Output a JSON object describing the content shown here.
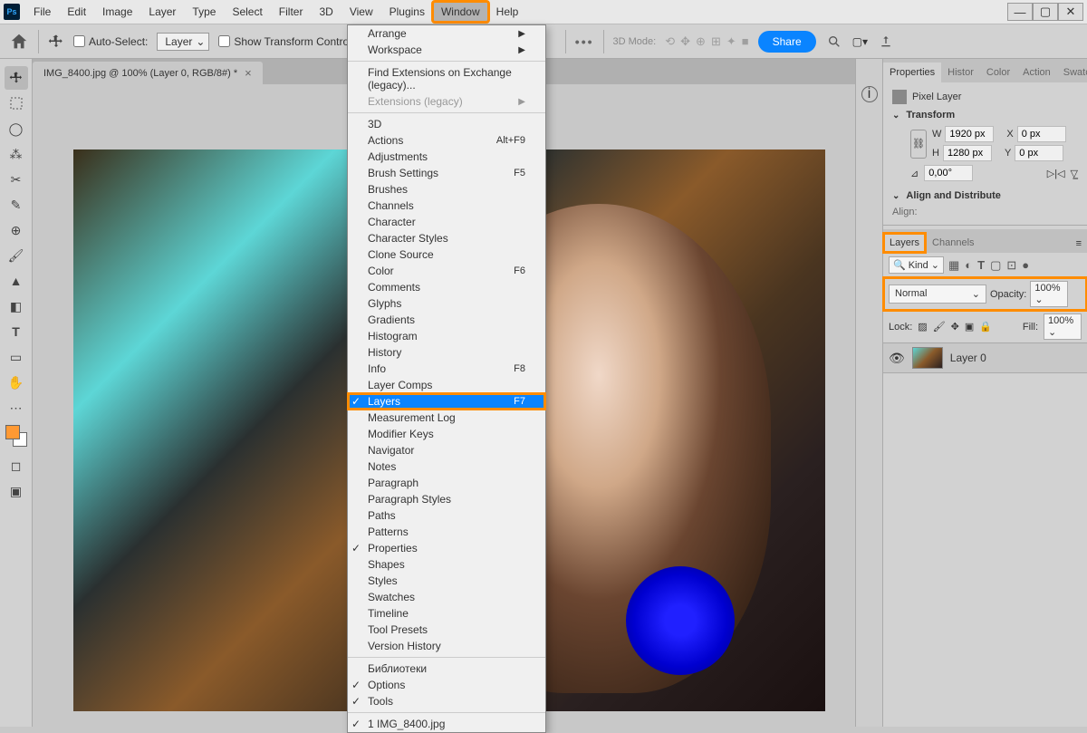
{
  "app": {
    "logo": "Ps"
  },
  "menubar": {
    "items": [
      "File",
      "Edit",
      "Image",
      "Layer",
      "Type",
      "Select",
      "Filter",
      "3D",
      "View",
      "Plugins",
      "Window",
      "Help"
    ],
    "active": "Window"
  },
  "window_controls": {
    "minimize": "—",
    "maximize": "▢",
    "close": "✕"
  },
  "optionsbar": {
    "auto_select": "Auto-Select:",
    "layer_select": "Layer",
    "show_transform": "Show Transform Controls",
    "mode3d": "3D Mode:",
    "share": "Share"
  },
  "doc_tab": {
    "label": "IMG_8400.jpg @ 100% (Layer 0, RGB/8#) *"
  },
  "dropdown": {
    "arrange": "Arrange",
    "workspace": "Workspace",
    "find_ext": "Find Extensions on Exchange (legacy)...",
    "ext_legacy": "Extensions (legacy)",
    "items1": [
      {
        "label": "3D"
      },
      {
        "label": "Actions",
        "shortcut": "Alt+F9"
      },
      {
        "label": "Adjustments"
      },
      {
        "label": "Brush Settings",
        "shortcut": "F5"
      },
      {
        "label": "Brushes"
      },
      {
        "label": "Channels"
      },
      {
        "label": "Character"
      },
      {
        "label": "Character Styles"
      },
      {
        "label": "Clone Source"
      },
      {
        "label": "Color",
        "shortcut": "F6"
      },
      {
        "label": "Comments"
      },
      {
        "label": "Glyphs"
      },
      {
        "label": "Gradients"
      },
      {
        "label": "Histogram"
      },
      {
        "label": "History"
      },
      {
        "label": "Info",
        "shortcut": "F8"
      },
      {
        "label": "Layer Comps"
      },
      {
        "label": "Layers",
        "shortcut": "F7",
        "checked": true,
        "selected": true
      },
      {
        "label": "Measurement Log"
      },
      {
        "label": "Modifier Keys"
      },
      {
        "label": "Navigator"
      },
      {
        "label": "Notes"
      },
      {
        "label": "Paragraph"
      },
      {
        "label": "Paragraph Styles"
      },
      {
        "label": "Paths"
      },
      {
        "label": "Patterns"
      },
      {
        "label": "Properties",
        "checked": true
      },
      {
        "label": "Shapes"
      },
      {
        "label": "Styles"
      },
      {
        "label": "Swatches"
      },
      {
        "label": "Timeline"
      },
      {
        "label": "Tool Presets"
      },
      {
        "label": "Version History"
      }
    ],
    "libraries": "Библиотеки",
    "options": "Options",
    "tools": "Tools",
    "open_doc": "1 IMG_8400.jpg"
  },
  "panels": {
    "top_tabs": [
      "Properties",
      "Histor",
      "Color",
      "Action",
      "Swatcl"
    ],
    "pixel_layer": "Pixel Layer",
    "transform": {
      "title": "Transform",
      "w_label": "W",
      "w": "1920 px",
      "h_label": "H",
      "h": "1280 px",
      "x_label": "X",
      "x": "0 px",
      "y_label": "Y",
      "y": "0 px",
      "angle": "0,00°"
    },
    "align_title": "Align and Distribute",
    "align_label": "Align:",
    "layer_tabs": [
      "Layers",
      "Channels"
    ],
    "kind": "Kind",
    "blend": "Normal",
    "opacity_label": "Opacity:",
    "opacity": "100%",
    "lock": "Lock:",
    "fill_label": "Fill:",
    "fill": "100%",
    "layer0": "Layer 0"
  }
}
